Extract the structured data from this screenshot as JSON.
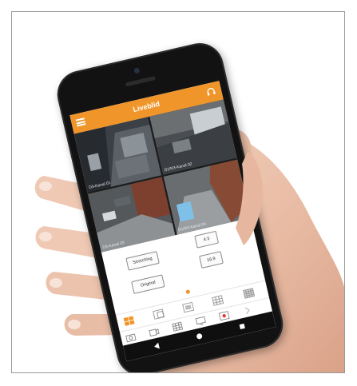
{
  "app": {
    "title": "Liveblid",
    "accent_color": "#f0952a",
    "icons": [
      "menu-icon",
      "headset-icon"
    ]
  },
  "cameras": [
    {
      "label": "D3-Kanal 01"
    },
    {
      "label": "D1/R3-Kanal 02"
    },
    {
      "label": "D3-Kanal 03"
    },
    {
      "label": "D1/R3-Kanal 04"
    }
  ],
  "controls": {
    "stretching_label": "Stretching",
    "original_label": "Original",
    "ratio_4_3_label": "4:3",
    "ratio_16_9_label": "16:9"
  },
  "layouts": [
    "layout-1x1-icon",
    "layout-1x2-icon",
    "layout-single-icon",
    "layout-3x3-icon",
    "layout-4x4-icon"
  ],
  "toolbar": [
    "snapshot-icon",
    "record-icon",
    "grid-icon",
    "monitor-icon",
    "alarm-icon",
    "next-icon"
  ],
  "navbar": [
    "back-icon",
    "home-icon",
    "recent-icon"
  ]
}
